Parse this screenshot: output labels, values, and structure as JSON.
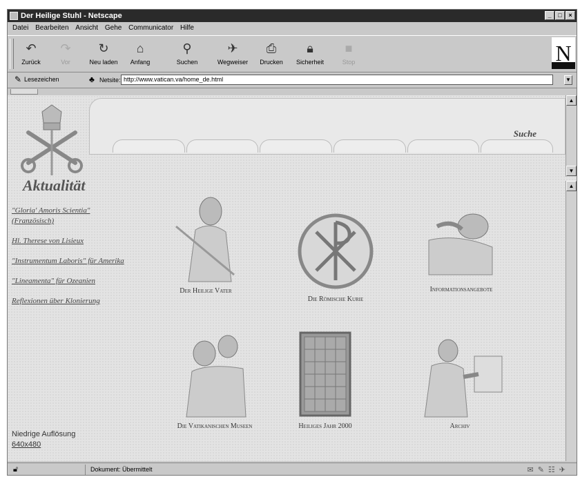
{
  "window": {
    "title": "Der Heilige Stuhl - Netscape"
  },
  "menu": [
    "Datei",
    "Bearbeiten",
    "Ansicht",
    "Gehe",
    "Communicator",
    "Hilfe"
  ],
  "toolbar": [
    {
      "label": "Zurück",
      "icon": "back-arrow-icon",
      "enabled": true
    },
    {
      "label": "Vor",
      "icon": "forward-arrow-icon",
      "enabled": false
    },
    {
      "label": "Neu laden",
      "icon": "reload-icon",
      "enabled": true
    },
    {
      "label": "Anfang",
      "icon": "home-icon",
      "enabled": true
    },
    {
      "label": "Suchen",
      "icon": "search-icon",
      "enabled": true
    },
    {
      "label": "Wegweiser",
      "icon": "guide-icon",
      "enabled": true
    },
    {
      "label": "Drucken",
      "icon": "print-icon",
      "enabled": true
    },
    {
      "label": "Sicherheit",
      "icon": "lock-icon",
      "enabled": true
    },
    {
      "label": "Stop",
      "icon": "stop-icon",
      "enabled": false
    }
  ],
  "location": {
    "bookmarks_label": "Lesezeichen",
    "netsite_label": "Netsite:",
    "url": "http://www.vatican.va/home_de.html"
  },
  "page": {
    "suche": "Suche",
    "aktualitaet": "Aktualität",
    "news_links": [
      "\"Gloria' Amoris Scientia\" (Französisch)",
      "Hl. Therese von Lisieux",
      "\"Instrumentum Laboris\" für Amerika",
      "\"Lineamenta\" für Ozeanien",
      "Reflexionen über Klonierung"
    ],
    "low_res": {
      "label": "Niedrige Auflösung",
      "link": "640x480"
    },
    "items": [
      {
        "label": "Der Heilige Vater",
        "icon": "pope-figure-icon"
      },
      {
        "label": "Die Römische Kurie",
        "icon": "chi-rho-medallion-icon"
      },
      {
        "label": "Informationsangebote",
        "icon": "sleeping-figure-icon"
      },
      {
        "label": "Die Vatikanischen Museen",
        "icon": "fresco-figures-icon"
      },
      {
        "label": "Heiliges Jahr 2000",
        "icon": "holy-door-icon"
      },
      {
        "label": "Archiv",
        "icon": "reading-figure-icon"
      }
    ]
  },
  "status": {
    "text": "Dokument: Übermittelt"
  }
}
